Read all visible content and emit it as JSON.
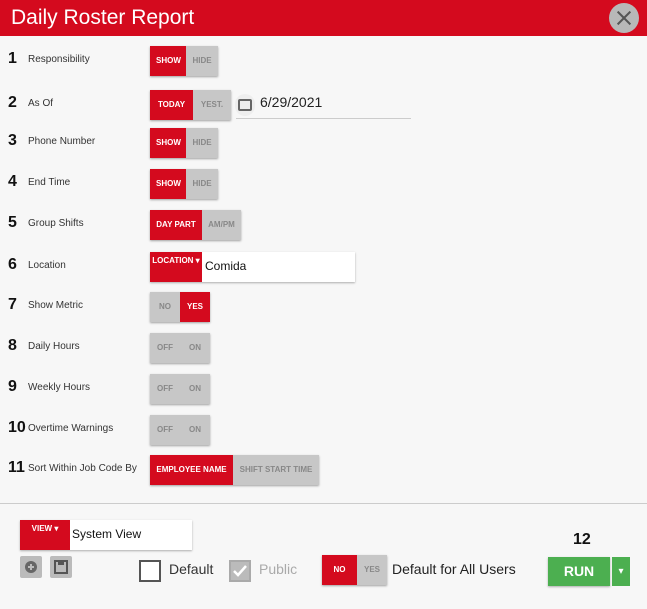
{
  "window": {
    "title": "Daily Roster Report"
  },
  "rows": [
    {
      "num": "1",
      "label": "Responsibility",
      "options": [
        "SHOW",
        "HIDE"
      ],
      "selected": 0
    },
    {
      "num": "2",
      "label": "As Of",
      "options": [
        "TODAY",
        "YEST."
      ],
      "selected": 0,
      "date": "6/29/2021"
    },
    {
      "num": "3",
      "label": "Phone Number",
      "options": [
        "SHOW",
        "HIDE"
      ],
      "selected": 0
    },
    {
      "num": "4",
      "label": "End Time",
      "options": [
        "SHOW",
        "HIDE"
      ],
      "selected": 0
    },
    {
      "num": "5",
      "label": "Group Shifts",
      "options": [
        "DAY PART",
        "AM/PM"
      ],
      "selected": 0
    },
    {
      "num": "6",
      "label": "Location",
      "button": "LOCATION ▾",
      "value": "Comida"
    },
    {
      "num": "7",
      "label": "Show Metric",
      "options": [
        "NO",
        "YES"
      ],
      "selected": 1
    },
    {
      "num": "8",
      "label": "Daily Hours",
      "options": [
        "OFF",
        "ON"
      ],
      "selected": -1
    },
    {
      "num": "9",
      "label": "Weekly Hours",
      "options": [
        "OFF",
        "ON"
      ],
      "selected": -1
    },
    {
      "num": "10",
      "label": "Overtime Warnings",
      "options": [
        "OFF",
        "ON"
      ],
      "selected": -1
    },
    {
      "num": "11",
      "label": "Sort Within Job Code By",
      "options": [
        "EMPLOYEE NAME",
        "SHIFT START TIME"
      ],
      "selected": 0
    }
  ],
  "footer": {
    "view_button": "VIEW ▾",
    "view_value": "System View",
    "default_label": "Default",
    "public_label": "Public",
    "default_all": {
      "options": [
        "NO",
        "YES"
      ],
      "selected": 0,
      "label": "Default for All Users"
    },
    "step_number": "12",
    "run_label": "RUN",
    "run_caret": "▾"
  }
}
